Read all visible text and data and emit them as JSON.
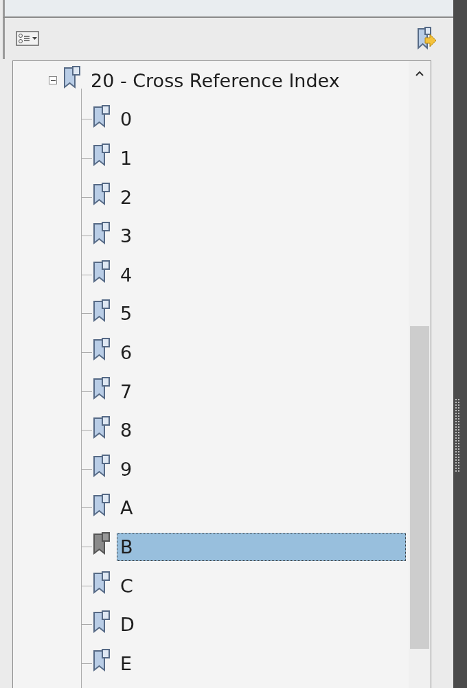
{
  "bookmarks": {
    "root": {
      "label": "20 - Cross Reference Index",
      "expanded": true,
      "selected": false,
      "children": [
        {
          "label": "0",
          "selected": false
        },
        {
          "label": "1",
          "selected": false
        },
        {
          "label": "2",
          "selected": false
        },
        {
          "label": "3",
          "selected": false
        },
        {
          "label": "4",
          "selected": false
        },
        {
          "label": "5",
          "selected": false
        },
        {
          "label": "6",
          "selected": false
        },
        {
          "label": "7",
          "selected": false
        },
        {
          "label": "8",
          "selected": false
        },
        {
          "label": "9",
          "selected": false
        },
        {
          "label": "A",
          "selected": false
        },
        {
          "label": "B",
          "selected": true
        },
        {
          "label": "C",
          "selected": false
        },
        {
          "label": "D",
          "selected": false
        },
        {
          "label": "E",
          "selected": false
        }
      ]
    }
  }
}
